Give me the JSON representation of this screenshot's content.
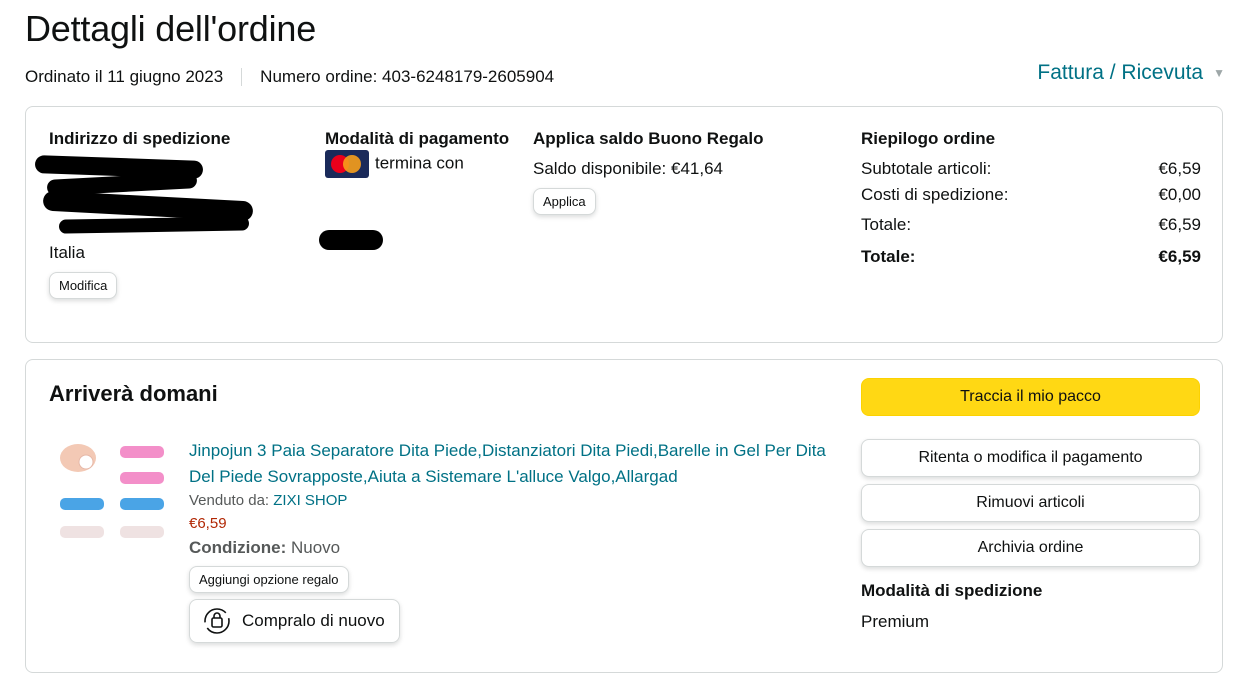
{
  "header": {
    "title": "Dettagli dell'ordine",
    "order_date": "Ordinato il 11 giugno 2023",
    "order_number": "Numero ordine: 403-6248179-2605904",
    "invoice_label": "Fattura / Ricevuta"
  },
  "shipping_address": {
    "heading": "Indirizzo di spedizione",
    "country": "Italia",
    "edit_label": "Modifica"
  },
  "payment": {
    "heading": "Modalità di pagamento",
    "card_text": "termina con"
  },
  "gift_card": {
    "heading": "Applica saldo Buono Regalo",
    "balance": "Saldo disponibile: €41,64",
    "apply_label": "Applica"
  },
  "summary": {
    "heading": "Riepilogo ordine",
    "rows": [
      {
        "label": "Subtotale articoli:",
        "value": "€6,59"
      },
      {
        "label": "Costi di spedizione:",
        "value": "€0,00"
      },
      {
        "label": "Totale:",
        "value": "€6,59"
      }
    ],
    "grand_total": {
      "label": "Totale:",
      "value": "€6,59"
    }
  },
  "shipment": {
    "status": "Arriverà domani",
    "product_title": "Jinpojun 3 Paia Separatore Dita Piede,Distanziatori Dita Piedi,Barelle in Gel Per Dita Del Piede Sovrapposte,Aiuta a Sistemare L'alluce Valgo,Allargad",
    "sold_by_label": "Venduto da:",
    "seller": "ZIXI SHOP",
    "price": "€6,59",
    "condition_label": "Condizione:",
    "condition_value": "Nuovo",
    "gift_option_label": "Aggiungi opzione regalo",
    "buy_again_label": "Compralo di nuovo"
  },
  "actions": {
    "track": "Traccia il mio pacco",
    "retry_payment": "Ritenta o modifica il pagamento",
    "remove_items": "Rimuovi articoli",
    "archive": "Archivia ordine"
  },
  "shipping_method": {
    "heading": "Modalità di spedizione",
    "value": "Premium"
  },
  "colors": {
    "link": "#007185",
    "primary_button": "#ffd814",
    "price": "#b12704"
  }
}
